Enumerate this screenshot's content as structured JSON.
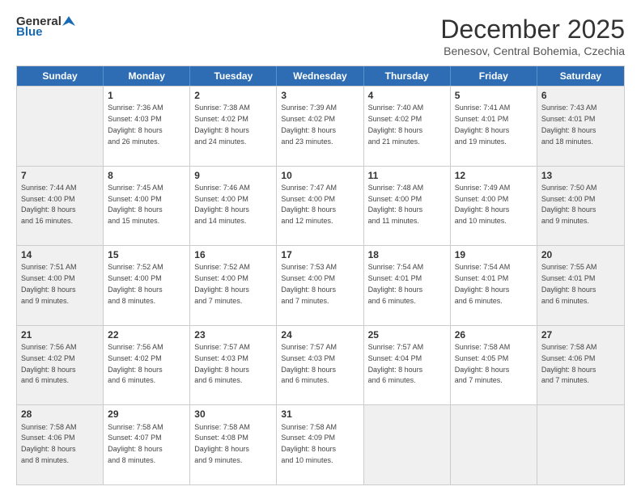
{
  "logo": {
    "general": "General",
    "blue": "Blue"
  },
  "header": {
    "month": "December 2025",
    "location": "Benesov, Central Bohemia, Czechia"
  },
  "weekdays": [
    "Sunday",
    "Monday",
    "Tuesday",
    "Wednesday",
    "Thursday",
    "Friday",
    "Saturday"
  ],
  "rows": [
    [
      {
        "day": "",
        "info": "",
        "shaded": true
      },
      {
        "day": "1",
        "info": "Sunrise: 7:36 AM\nSunset: 4:03 PM\nDaylight: 8 hours\nand 26 minutes.",
        "shaded": false
      },
      {
        "day": "2",
        "info": "Sunrise: 7:38 AM\nSunset: 4:02 PM\nDaylight: 8 hours\nand 24 minutes.",
        "shaded": false
      },
      {
        "day": "3",
        "info": "Sunrise: 7:39 AM\nSunset: 4:02 PM\nDaylight: 8 hours\nand 23 minutes.",
        "shaded": false
      },
      {
        "day": "4",
        "info": "Sunrise: 7:40 AM\nSunset: 4:02 PM\nDaylight: 8 hours\nand 21 minutes.",
        "shaded": false
      },
      {
        "day": "5",
        "info": "Sunrise: 7:41 AM\nSunset: 4:01 PM\nDaylight: 8 hours\nand 19 minutes.",
        "shaded": false
      },
      {
        "day": "6",
        "info": "Sunrise: 7:43 AM\nSunset: 4:01 PM\nDaylight: 8 hours\nand 18 minutes.",
        "shaded": true
      }
    ],
    [
      {
        "day": "7",
        "info": "Sunrise: 7:44 AM\nSunset: 4:00 PM\nDaylight: 8 hours\nand 16 minutes.",
        "shaded": true
      },
      {
        "day": "8",
        "info": "Sunrise: 7:45 AM\nSunset: 4:00 PM\nDaylight: 8 hours\nand 15 minutes.",
        "shaded": false
      },
      {
        "day": "9",
        "info": "Sunrise: 7:46 AM\nSunset: 4:00 PM\nDaylight: 8 hours\nand 14 minutes.",
        "shaded": false
      },
      {
        "day": "10",
        "info": "Sunrise: 7:47 AM\nSunset: 4:00 PM\nDaylight: 8 hours\nand 12 minutes.",
        "shaded": false
      },
      {
        "day": "11",
        "info": "Sunrise: 7:48 AM\nSunset: 4:00 PM\nDaylight: 8 hours\nand 11 minutes.",
        "shaded": false
      },
      {
        "day": "12",
        "info": "Sunrise: 7:49 AM\nSunset: 4:00 PM\nDaylight: 8 hours\nand 10 minutes.",
        "shaded": false
      },
      {
        "day": "13",
        "info": "Sunrise: 7:50 AM\nSunset: 4:00 PM\nDaylight: 8 hours\nand 9 minutes.",
        "shaded": true
      }
    ],
    [
      {
        "day": "14",
        "info": "Sunrise: 7:51 AM\nSunset: 4:00 PM\nDaylight: 8 hours\nand 9 minutes.",
        "shaded": true
      },
      {
        "day": "15",
        "info": "Sunrise: 7:52 AM\nSunset: 4:00 PM\nDaylight: 8 hours\nand 8 minutes.",
        "shaded": false
      },
      {
        "day": "16",
        "info": "Sunrise: 7:52 AM\nSunset: 4:00 PM\nDaylight: 8 hours\nand 7 minutes.",
        "shaded": false
      },
      {
        "day": "17",
        "info": "Sunrise: 7:53 AM\nSunset: 4:00 PM\nDaylight: 8 hours\nand 7 minutes.",
        "shaded": false
      },
      {
        "day": "18",
        "info": "Sunrise: 7:54 AM\nSunset: 4:01 PM\nDaylight: 8 hours\nand 6 minutes.",
        "shaded": false
      },
      {
        "day": "19",
        "info": "Sunrise: 7:54 AM\nSunset: 4:01 PM\nDaylight: 8 hours\nand 6 minutes.",
        "shaded": false
      },
      {
        "day": "20",
        "info": "Sunrise: 7:55 AM\nSunset: 4:01 PM\nDaylight: 8 hours\nand 6 minutes.",
        "shaded": true
      }
    ],
    [
      {
        "day": "21",
        "info": "Sunrise: 7:56 AM\nSunset: 4:02 PM\nDaylight: 8 hours\nand 6 minutes.",
        "shaded": true
      },
      {
        "day": "22",
        "info": "Sunrise: 7:56 AM\nSunset: 4:02 PM\nDaylight: 8 hours\nand 6 minutes.",
        "shaded": false
      },
      {
        "day": "23",
        "info": "Sunrise: 7:57 AM\nSunset: 4:03 PM\nDaylight: 8 hours\nand 6 minutes.",
        "shaded": false
      },
      {
        "day": "24",
        "info": "Sunrise: 7:57 AM\nSunset: 4:03 PM\nDaylight: 8 hours\nand 6 minutes.",
        "shaded": false
      },
      {
        "day": "25",
        "info": "Sunrise: 7:57 AM\nSunset: 4:04 PM\nDaylight: 8 hours\nand 6 minutes.",
        "shaded": false
      },
      {
        "day": "26",
        "info": "Sunrise: 7:58 AM\nSunset: 4:05 PM\nDaylight: 8 hours\nand 7 minutes.",
        "shaded": false
      },
      {
        "day": "27",
        "info": "Sunrise: 7:58 AM\nSunset: 4:06 PM\nDaylight: 8 hours\nand 7 minutes.",
        "shaded": true
      }
    ],
    [
      {
        "day": "28",
        "info": "Sunrise: 7:58 AM\nSunset: 4:06 PM\nDaylight: 8 hours\nand 8 minutes.",
        "shaded": true
      },
      {
        "day": "29",
        "info": "Sunrise: 7:58 AM\nSunset: 4:07 PM\nDaylight: 8 hours\nand 8 minutes.",
        "shaded": false
      },
      {
        "day": "30",
        "info": "Sunrise: 7:58 AM\nSunset: 4:08 PM\nDaylight: 8 hours\nand 9 minutes.",
        "shaded": false
      },
      {
        "day": "31",
        "info": "Sunrise: 7:58 AM\nSunset: 4:09 PM\nDaylight: 8 hours\nand 10 minutes.",
        "shaded": false
      },
      {
        "day": "",
        "info": "",
        "shaded": true
      },
      {
        "day": "",
        "info": "",
        "shaded": true
      },
      {
        "day": "",
        "info": "",
        "shaded": true
      }
    ]
  ]
}
